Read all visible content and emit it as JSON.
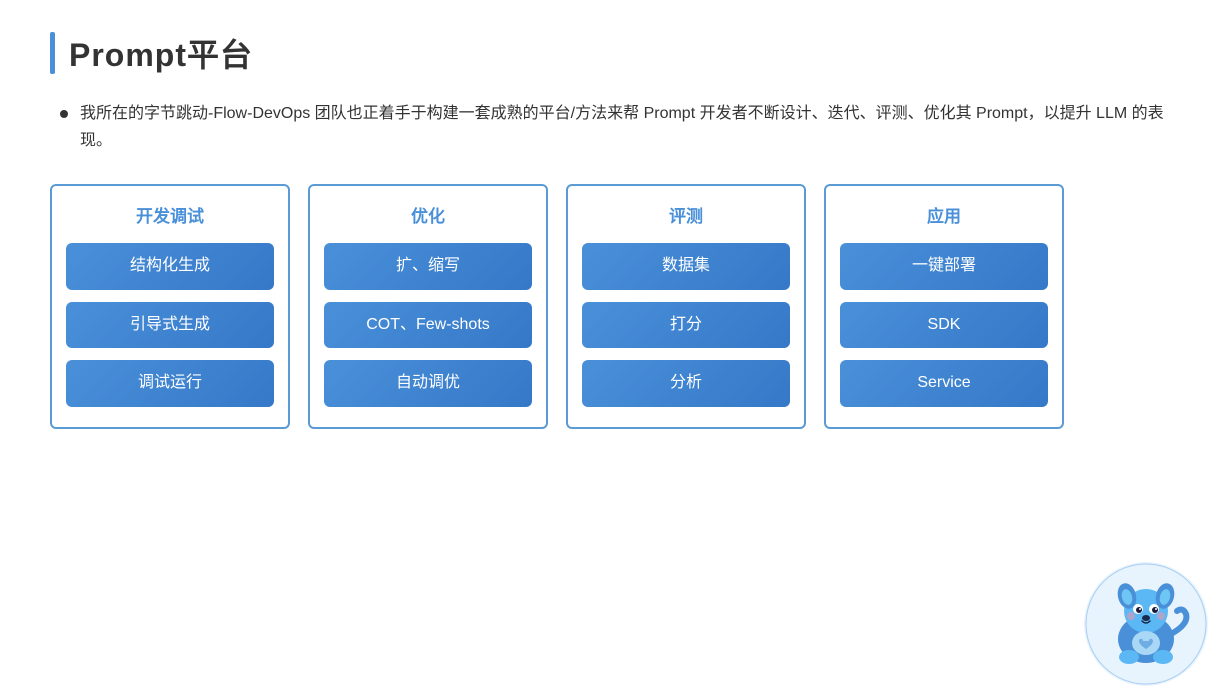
{
  "page": {
    "title": "Prompt平台",
    "accent_color": "#4A90D9"
  },
  "bullet": {
    "text": "我所在的字节跳动-Flow-DevOps 团队也正着手于构建一套成熟的平台/方法来帮 Prompt 开发者不断设计、迭代、评测、优化其 Prompt，以提升 LLM 的表现。"
  },
  "cards": [
    {
      "id": "dev",
      "header": "开发调试",
      "buttons": [
        {
          "label": "结构化生成"
        },
        {
          "label": "引导式生成"
        },
        {
          "label": "调试运行"
        }
      ]
    },
    {
      "id": "optimize",
      "header": "优化",
      "buttons": [
        {
          "label": "扩、缩写"
        },
        {
          "label": "COT、Few-shots"
        },
        {
          "label": "自动调优"
        }
      ]
    },
    {
      "id": "evaluate",
      "header": "评测",
      "buttons": [
        {
          "label": "数据集"
        },
        {
          "label": "打分"
        },
        {
          "label": "分析"
        }
      ]
    },
    {
      "id": "apply",
      "header": "应用",
      "buttons": [
        {
          "label": "一键部署"
        },
        {
          "label": "SDK"
        },
        {
          "label": "Service"
        }
      ]
    }
  ]
}
